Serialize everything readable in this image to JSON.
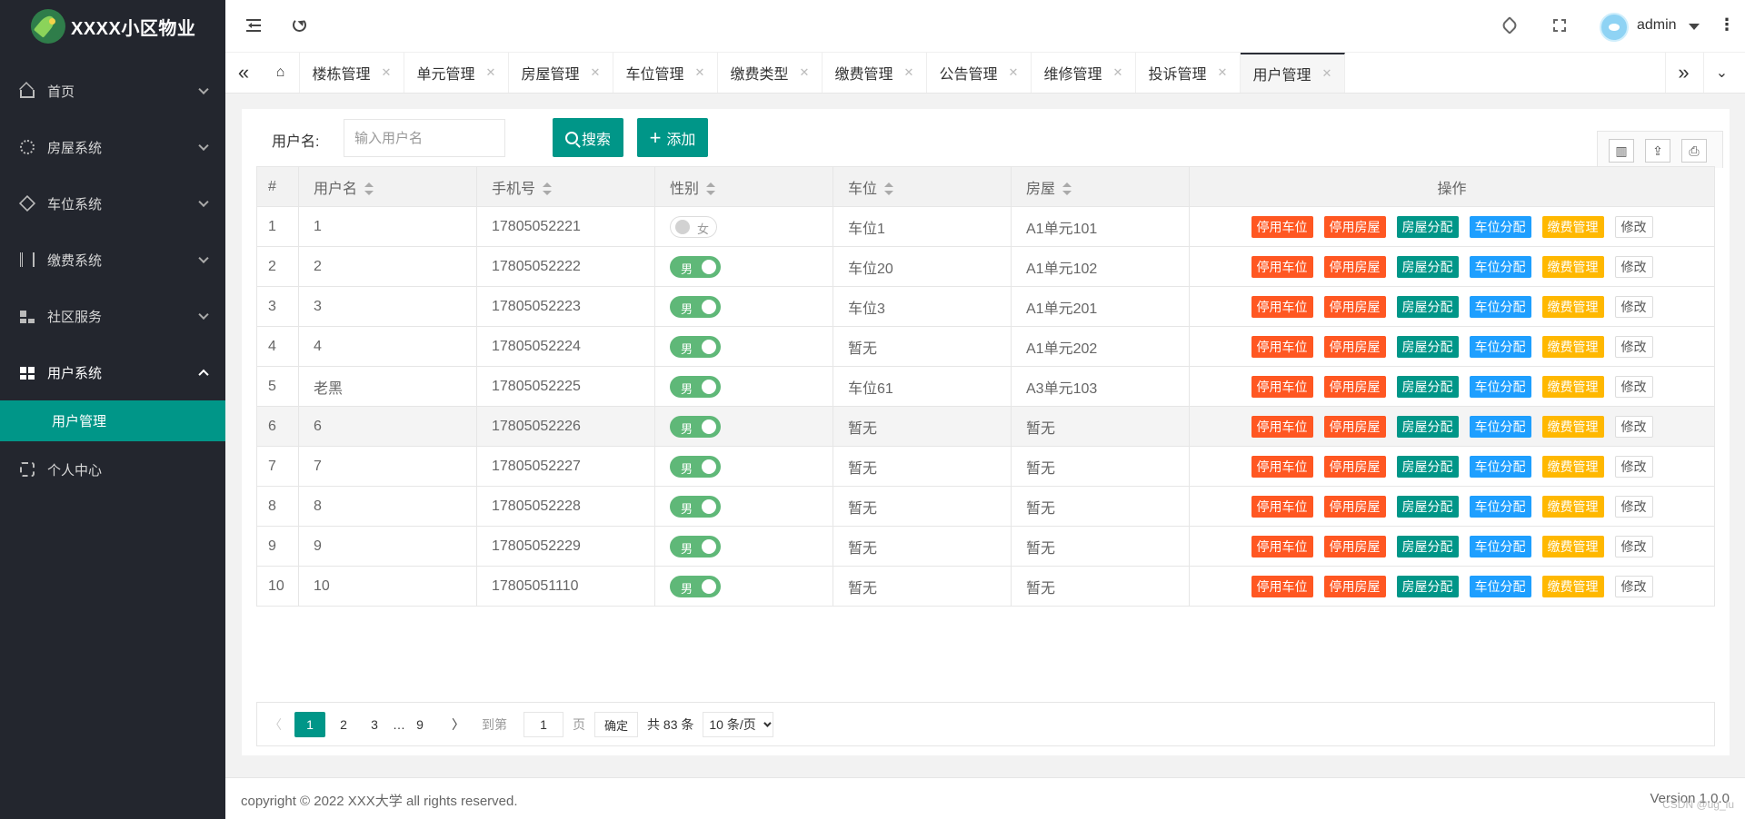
{
  "app": {
    "title": "XXXX小区物业",
    "user": "admin"
  },
  "sidebar": {
    "items": [
      {
        "label": "首页",
        "icon": "home-icon"
      },
      {
        "label": "房屋系统",
        "icon": "gear-icon"
      },
      {
        "label": "车位系统",
        "icon": "cube-icon"
      },
      {
        "label": "缴费系统",
        "icon": "book-icon"
      },
      {
        "label": "社区服务",
        "icon": "grid-icon"
      },
      {
        "label": "用户系统",
        "icon": "grid-icon"
      },
      {
        "label": "个人中心",
        "icon": "gear-icon"
      }
    ],
    "active_sub": "用户管理"
  },
  "tabs": [
    "楼栋管理",
    "单元管理",
    "房屋管理",
    "车位管理",
    "缴费类型",
    "缴费管理",
    "公告管理",
    "维修管理",
    "投诉管理",
    "用户管理"
  ],
  "active_tab": "用户管理",
  "search": {
    "label": "用户名:",
    "placeholder": "输入用户名",
    "search_btn": "搜索",
    "add_btn": "添加"
  },
  "table": {
    "columns": [
      "#",
      "用户名",
      "手机号",
      "性别",
      "车位",
      "房屋",
      "操作"
    ],
    "rows": [
      {
        "id": "1",
        "name": "1",
        "phone": "17805052221",
        "gender": "女",
        "gender_on": false,
        "parking": "车位1",
        "house": "A1单元101"
      },
      {
        "id": "2",
        "name": "2",
        "phone": "17805052222",
        "gender": "男",
        "gender_on": true,
        "parking": "车位20",
        "house": "A1单元102"
      },
      {
        "id": "3",
        "name": "3",
        "phone": "17805052223",
        "gender": "男",
        "gender_on": true,
        "parking": "车位3",
        "house": "A1单元201"
      },
      {
        "id": "4",
        "name": "4",
        "phone": "17805052224",
        "gender": "男",
        "gender_on": true,
        "parking": "暂无",
        "house": "A1单元202"
      },
      {
        "id": "5",
        "name": "老黑",
        "phone": "17805052225",
        "gender": "男",
        "gender_on": true,
        "parking": "车位61",
        "house": "A3单元103"
      },
      {
        "id": "6",
        "name": "6",
        "phone": "17805052226",
        "gender": "男",
        "gender_on": true,
        "parking": "暂无",
        "house": "暂无"
      },
      {
        "id": "7",
        "name": "7",
        "phone": "17805052227",
        "gender": "男",
        "gender_on": true,
        "parking": "暂无",
        "house": "暂无"
      },
      {
        "id": "8",
        "name": "8",
        "phone": "17805052228",
        "gender": "男",
        "gender_on": true,
        "parking": "暂无",
        "house": "暂无"
      },
      {
        "id": "9",
        "name": "9",
        "phone": "17805052229",
        "gender": "男",
        "gender_on": true,
        "parking": "暂无",
        "house": "暂无"
      },
      {
        "id": "10",
        "name": "10",
        "phone": "17805051110",
        "gender": "男",
        "gender_on": true,
        "parking": "暂无",
        "house": "暂无"
      }
    ],
    "actions": [
      {
        "label": "停用车位",
        "color": "#ff5722"
      },
      {
        "label": "停用房屋",
        "color": "#ff5722"
      },
      {
        "label": "房屋分配",
        "color": "#009688"
      },
      {
        "label": "车位分配",
        "color": "#1e9fff"
      },
      {
        "label": "缴费管理",
        "color": "#ffb800"
      },
      {
        "label": "修改",
        "color": "#ffffff"
      }
    ]
  },
  "pagination": {
    "pages": [
      "1",
      "2",
      "3",
      "…",
      "9"
    ],
    "current": "1",
    "goto_label": "到第",
    "goto_value": "1",
    "page_unit": "页",
    "confirm": "确定",
    "total": "共 83 条",
    "per_page": "10 条/页"
  },
  "footer": {
    "copyright": "copyright © 2022 XXX大学 all rights reserved.",
    "version": "Version 1.0.0",
    "watermark": "CSDN @ug_lu"
  },
  "colors": {
    "accent": "#009688",
    "sidebar_bg": "#23262e",
    "danger": "#ff5722",
    "info": "#1e9fff",
    "warn": "#ffb800",
    "switch_on": "#5fb878"
  }
}
